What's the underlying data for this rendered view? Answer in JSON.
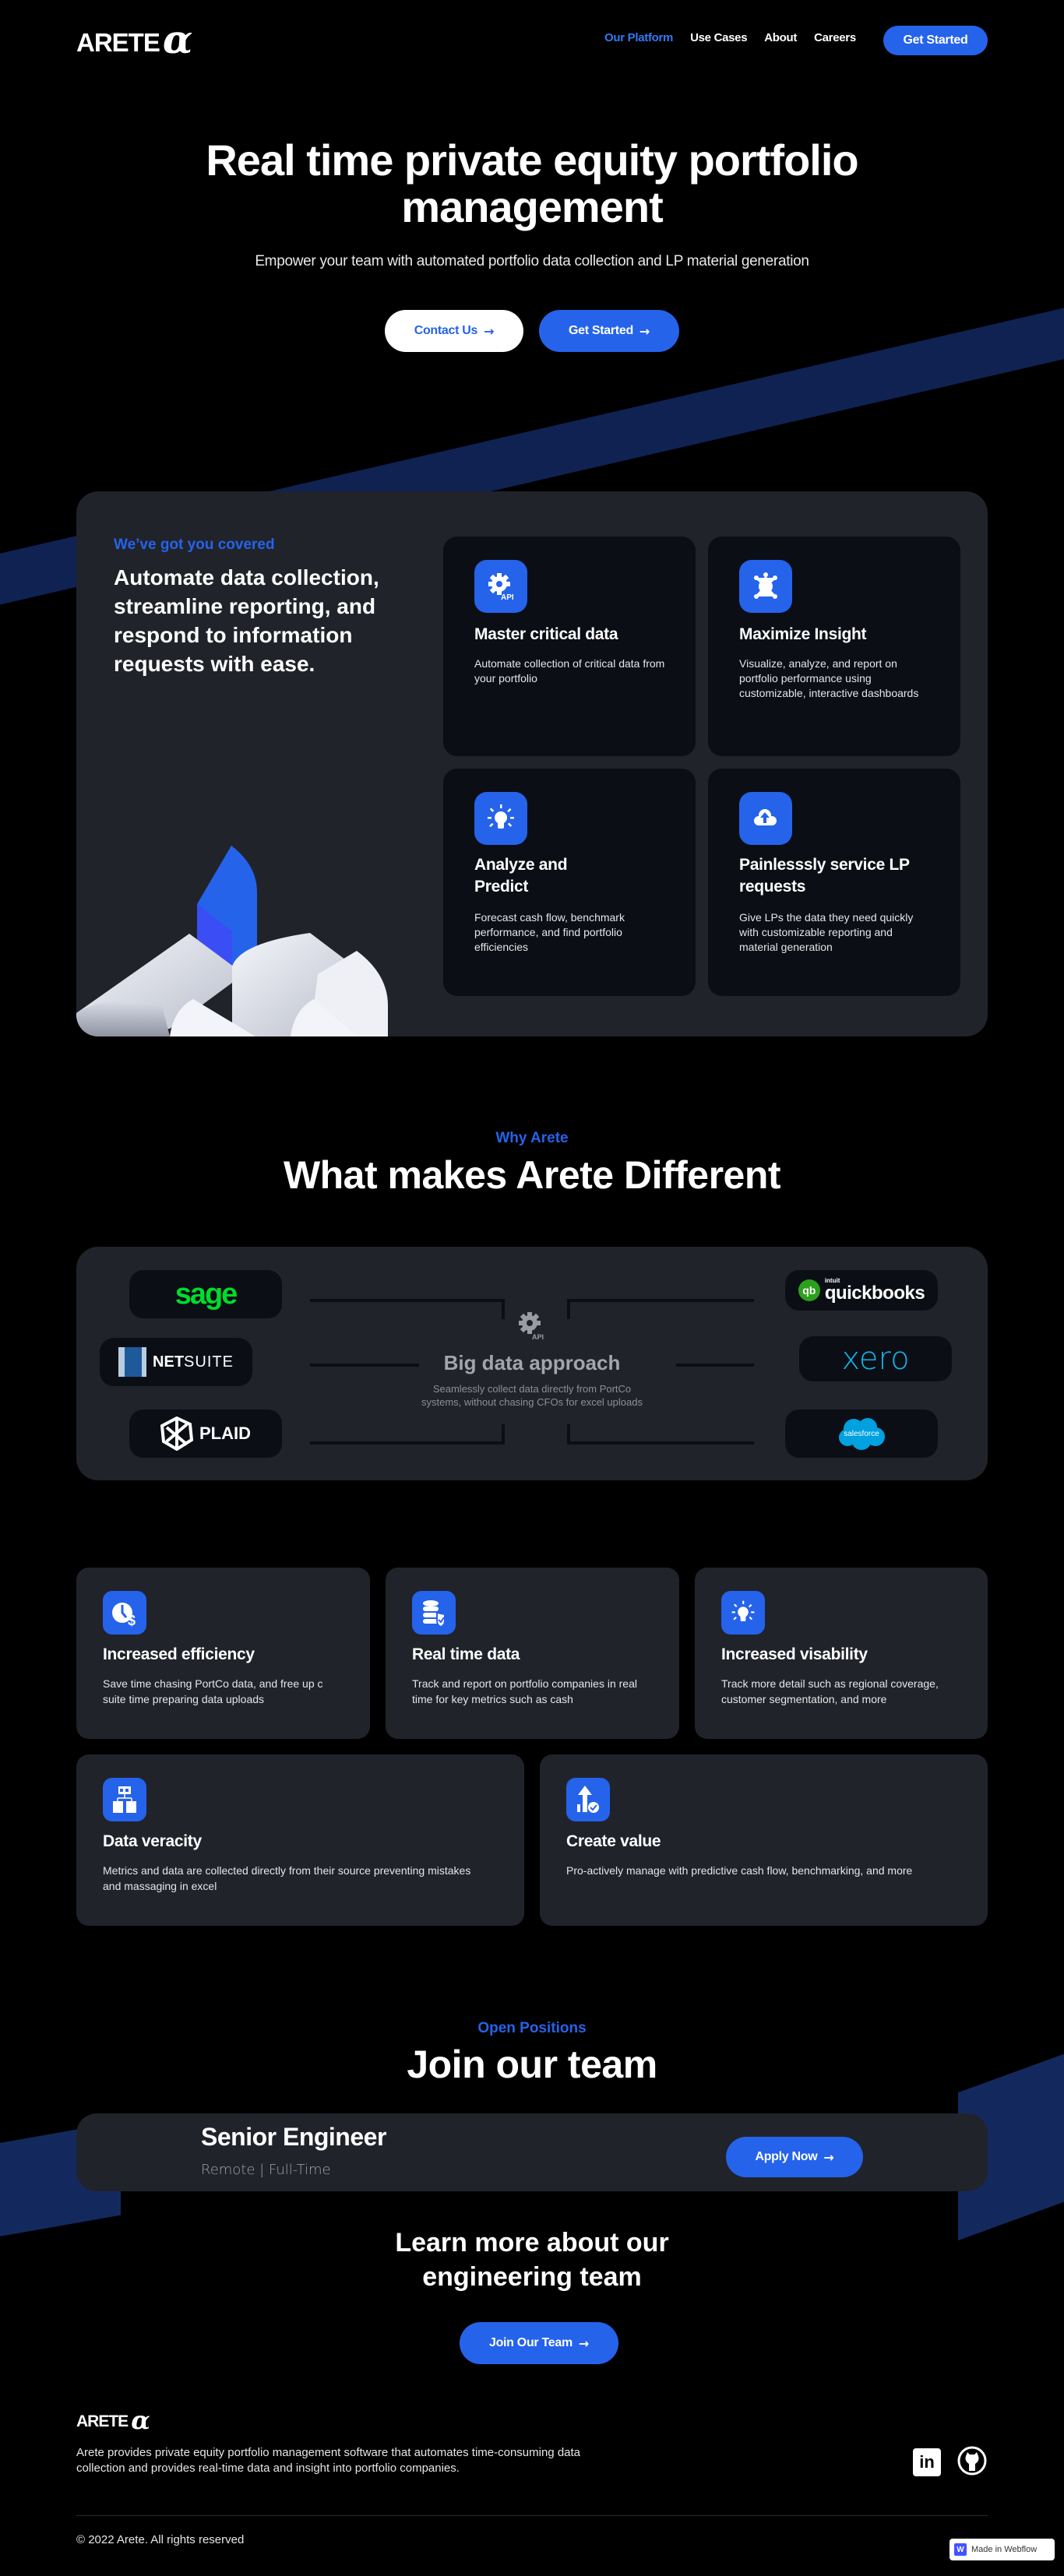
{
  "brand": {
    "name": "ARETE",
    "symbol": "α"
  },
  "nav": {
    "links": [
      {
        "label": "Our Platform",
        "active": true
      },
      {
        "label": "Use Cases",
        "active": false
      },
      {
        "label": "About",
        "active": false
      },
      {
        "label": "Careers",
        "active": false
      }
    ],
    "cta_label": "Get Started"
  },
  "hero": {
    "title": "Real time private equity portfolio management",
    "subtitle": "Empower your team with automated portfolio data collection and LP material generation",
    "contact_label": "Contact Us",
    "get_started_label": "Get Started",
    "arrow": "→"
  },
  "covered": {
    "eyebrow": "We’ve got you covered",
    "headline": "Automate data collection, streamline reporting, and respond to information requests with ease.",
    "cards": [
      {
        "icon": "api-gear-icon",
        "title": "Master critical data",
        "desc": "Automate collection of critical data from your portfolio"
      },
      {
        "icon": "network-insight-icon",
        "title": "Maximize Insight",
        "desc": "Visualize, analyze, and report on portfolio performance using customizable, interactive dashboards"
      },
      {
        "icon": "lightbulb-icon",
        "title": "Analyze and Predict",
        "desc": "Forecast cash flow, benchmark performance, and find portfolio efficiencies"
      },
      {
        "icon": "cloud-upload-icon",
        "title": "Painlesssly service LP requests",
        "desc": "Give LPs the data they need quickly with customizable reporting and material generation"
      }
    ]
  },
  "why": {
    "eyebrow": "Why Arete",
    "title": "What makes Arete Different",
    "center_title": "Big data approach",
    "center_api_label": "API",
    "center_desc": "Seamlessly collect data directly from PortCo systems, without chasing CFOs for excel uploads",
    "integrations_left": [
      "sage",
      "NETSUITE",
      "PLAID"
    ],
    "integrations_right": [
      "quickbooks",
      "xero",
      "salesforce"
    ],
    "quickbooks_prefix": "intuit",
    "netsuite_bold": "NET",
    "netsuite_light": "SUITE"
  },
  "benefits": [
    {
      "icon": "clock-dollar-icon",
      "title": "Increased efficiency",
      "desc": "Save time chasing PortCo data, and free up c suite time preparing data uploads"
    },
    {
      "icon": "database-shield-icon",
      "title": "Real time data",
      "desc": "Track and report on portfolio companies in real time for key metrics such as cash"
    },
    {
      "icon": "lightbulb-icon",
      "title": "Increased visability",
      "desc": "Track more detail such as regional coverage, customer segmentation, and more"
    },
    {
      "icon": "hierarchy-icon",
      "title": "Data veracity",
      "desc": "Metrics and data are collected directly from their source preventing mistakes and massaging in excel"
    },
    {
      "icon": "growth-check-icon",
      "title": "Create value",
      "desc": "Pro-actively manage with predictive cash flow, benchmarking, and more"
    }
  ],
  "careers": {
    "eyebrow": "Open Positions",
    "title": "Join our team",
    "job": {
      "title": "Senior Engineer",
      "meta": "Remote | Full-Time",
      "apply_label": "Apply Now"
    },
    "learn_more": "Learn more about our engineering team",
    "join_label": "Join Our Team"
  },
  "footer": {
    "description": "Arete provides private equity portfolio management software that automates time-consuming data collection and provides real-time data and insight into portfolio companies.",
    "copyright": "© 2022 Arete. All rights reserved",
    "social": [
      "linkedin-icon",
      "github-icon"
    ],
    "webflow_badge": "Made in Webflow"
  },
  "colors": {
    "accent": "#2563eb",
    "panel": "#21232b",
    "card": "#0b0e15",
    "band": "#0f2252"
  }
}
